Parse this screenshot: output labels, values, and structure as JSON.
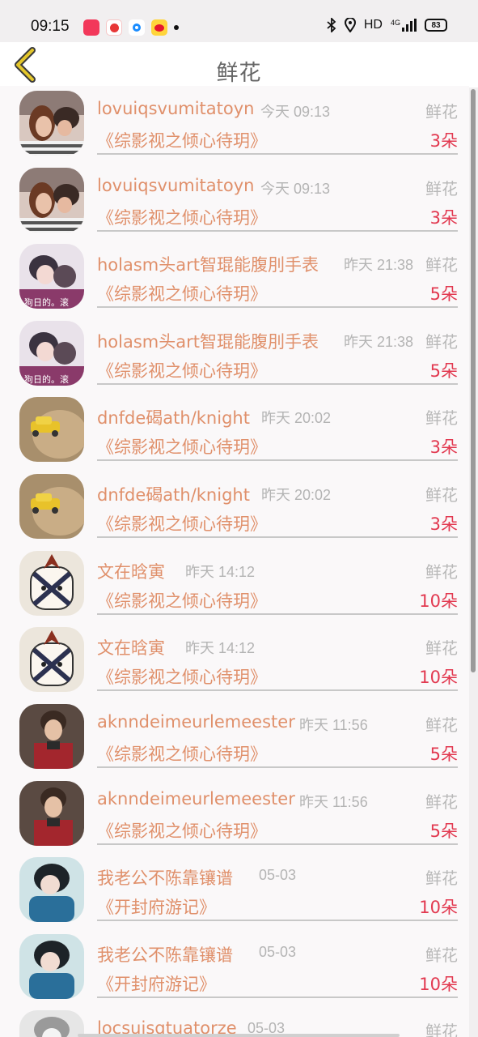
{
  "status": {
    "time": "09:15",
    "network": "HD",
    "net_type": "4G",
    "battery": "83"
  },
  "header": {
    "title": "鲜花",
    "back_icon": "chevron-left-icon",
    "back_color": "#e3c62b"
  },
  "rows": [
    {
      "user": "lovuiqsvumitatoyn",
      "time": "今天 09:13",
      "type": "鲜花",
      "book": "《综影视之倾心待玥》",
      "count": "3朵",
      "avatar": "couple-photo"
    },
    {
      "user": "lovuiqsvumitatoyn",
      "time": "今天 09:13",
      "type": "鲜花",
      "book": "《综影视之倾心待玥》",
      "count": "3朵",
      "avatar": "couple-photo"
    },
    {
      "user": "holasm头art智琨能腹刖手表",
      "time": "昨天 21:38",
      "type": "鲜花",
      "book": "《综影视之倾心待玥》",
      "count": "5朵",
      "avatar": "anime-couple",
      "avatar_caption": "狗日的。滚"
    },
    {
      "user": "holasm头art智琨能腹刖手表",
      "time": "昨天 21:38",
      "type": "鲜花",
      "book": "《综影视之倾心待玥》",
      "count": "5朵",
      "avatar": "anime-couple",
      "avatar_caption": "狗日的。滚"
    },
    {
      "user": "dnfde碣ath/knight",
      "time": "昨天 20:02",
      "type": "鲜花",
      "book": "《综影视之倾心待玥》",
      "count": "3朵",
      "avatar": "toy-car"
    },
    {
      "user": "dnfde碣ath/knight",
      "time": "昨天 20:02",
      "type": "鲜花",
      "book": "《综影视之倾心待玥》",
      "count": "3朵",
      "avatar": "toy-car"
    },
    {
      "user": "文在晗寅",
      "time": "昨天 14:12",
      "type": "鲜花",
      "book": "《综影视之倾心待玥》",
      "count": "10朵",
      "avatar": "cartoon-mascot"
    },
    {
      "user": "文在晗寅",
      "time": "昨天 14:12",
      "type": "鲜花",
      "book": "《综影视之倾心待玥》",
      "count": "10朵",
      "avatar": "cartoon-mascot"
    },
    {
      "user": "aknndeimeurlemeester",
      "time": "昨天 11:56",
      "type": "鲜花",
      "book": "《综影视之倾心待玥》",
      "count": "5朵",
      "avatar": "man-red-sweater"
    },
    {
      "user": "aknndeimeurlemeester",
      "time": "昨天 11:56",
      "type": "鲜花",
      "book": "《综影视之倾心待玥》",
      "count": "5朵",
      "avatar": "man-red-sweater"
    },
    {
      "user": "我老公不陈靠镶谱",
      "time": "05-03",
      "type": "鲜花",
      "book": "《开封府游记》",
      "count": "10朵",
      "avatar": "anime-boy-blue"
    },
    {
      "user": "我老公不陈靠镶谱",
      "time": "05-03",
      "type": "鲜花",
      "book": "《开封府游记》",
      "count": "10朵",
      "avatar": "anime-boy-blue"
    },
    {
      "user": "locsuisqtuatorze",
      "time": "05-03",
      "type": "鲜花",
      "book": "",
      "count": "",
      "avatar": "sketch-portrait"
    }
  ]
}
